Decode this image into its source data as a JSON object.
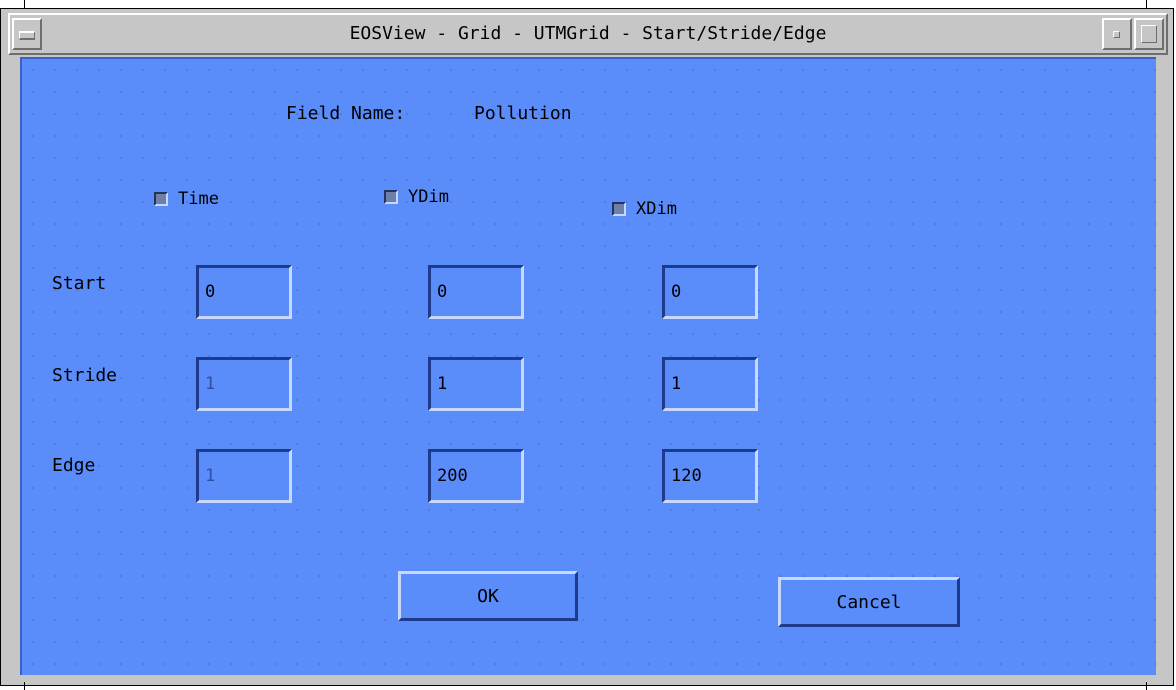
{
  "window": {
    "title": "EOSView - Grid - UTMGrid - Start/Stride/Edge"
  },
  "field_name": {
    "label": "Field Name:",
    "value": "Pollution"
  },
  "dimensions": [
    {
      "label": "Time",
      "checked": false
    },
    {
      "label": "YDim",
      "checked": true
    },
    {
      "label": "XDim",
      "checked": true
    }
  ],
  "rows": [
    {
      "label": "Start",
      "values": [
        "0",
        "0",
        "0"
      ]
    },
    {
      "label": "Stride",
      "values": [
        "1",
        "1",
        "1"
      ]
    },
    {
      "label": "Edge",
      "values": [
        "1",
        "200",
        "120"
      ]
    }
  ],
  "buttons": {
    "ok": "OK",
    "cancel": "Cancel"
  },
  "colors": {
    "client_bg": "#5a8cfa",
    "frame_bg": "#c6c6c6"
  },
  "icons": {
    "window_menu": "window-menu-icon",
    "minimize": "minimize-icon",
    "maximize": "maximize-icon"
  }
}
